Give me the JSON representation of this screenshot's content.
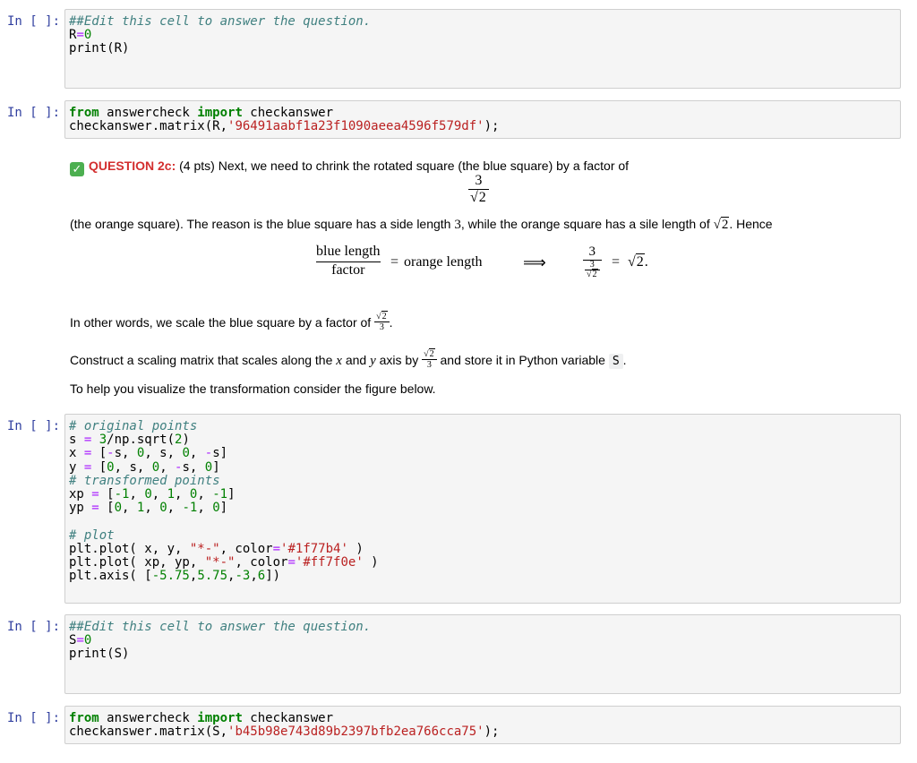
{
  "colors": {
    "prompt": "#303f9f",
    "cell_bg": "#f5f5f5",
    "question": "#d32f2f",
    "check": "#4caf50"
  },
  "cells": {
    "c1": {
      "prompt": "In [ ]:",
      "comment": "##Edit this cell to answer the question.",
      "line_a_var": "R",
      "line_a_eq": "=",
      "line_a_val": "0",
      "line_b": "print(R)"
    },
    "c2": {
      "prompt": "In [ ]:",
      "kw_from": "from",
      "module": " answercheck ",
      "kw_import": "import",
      "name": " checkanswer",
      "call": "checkanswer.matrix(R,",
      "hash": "'96491aabf1a23f1090aeea4596f579df'",
      "end": ");"
    },
    "c3": {
      "prompt": "In [ ]:",
      "comment1": "# original points",
      "comment2": "# transformed points",
      "comment3": "# plot",
      "s_line": [
        "s ",
        "= ",
        "3",
        "/np.sqrt(",
        "2",
        ")"
      ],
      "x_line": [
        "x ",
        "= ",
        "[",
        "-",
        "s, ",
        "0",
        ", s, ",
        "0",
        ", ",
        "-",
        "s]"
      ],
      "y_line": [
        "y ",
        "= ",
        "[",
        "0",
        ", s, ",
        "0",
        ", ",
        "-",
        "s, ",
        "0",
        "]"
      ],
      "xp_line": [
        "xp ",
        "= ",
        "[",
        "-1",
        ", ",
        "0",
        ", ",
        "1",
        ", ",
        "0",
        ", ",
        "-1",
        "]"
      ],
      "yp_line": [
        "yp ",
        "= ",
        "[",
        "0",
        ", ",
        "1",
        ", ",
        "0",
        ", ",
        "-1",
        ", ",
        "0",
        "]"
      ],
      "plot1": [
        "plt.plot( x, y, ",
        "\"*-\"",
        ", color",
        "=",
        "'#1f77b4'",
        " )"
      ],
      "plot2": [
        "plt.plot( xp, yp, ",
        "\"*-\"",
        ", color",
        "=",
        "'#ff7f0e'",
        " )"
      ],
      "axis": [
        "plt.axis( [",
        "-5.75",
        ",",
        "5.75",
        ",",
        "-3",
        ",",
        "6",
        "])"
      ]
    },
    "c4": {
      "prompt": "In [ ]:",
      "comment": "##Edit this cell to answer the question.",
      "line_a_var": "S",
      "line_a_eq": "=",
      "line_a_val": "0",
      "line_b": "print(S)"
    },
    "c5": {
      "prompt": "In [ ]:",
      "kw_from": "from",
      "module": " answercheck ",
      "kw_import": "import",
      "name": " checkanswer",
      "call": "checkanswer.matrix(S,",
      "hash": "'b45b98e743d89b2397bfb2ea766cca75'",
      "end": ");"
    }
  },
  "markdown": {
    "check_icon": "check-mark-icon",
    "check_glyph": "✓",
    "q_label": "QUESTION 2c:",
    "q_text1": " (4 pts) Next, we need to chrink the rotated square (the blue square) by a factor of",
    "frac1_num": "3",
    "frac1_den": "2",
    "para2_a": "(the orange square). The reason is the blue square has a side length ",
    "para2_3": "3",
    "para2_b": ", while the orange square has a sile length of ",
    "para2_c": ". Hence",
    "eq_blue_length": "blue length",
    "eq_factor": "factor",
    "eq_equals": "=",
    "eq_orange_length": "orange length",
    "eq_implies": "⟹",
    "eq_r_num": "3",
    "eq_r_inner_num": "3",
    "eq_r_inner_den": "2",
    "eq_r_equals": "=",
    "eq_r_val": "2",
    "eq_period": ".",
    "para3": "In other words, we scale the blue square by a factor of ",
    "para3_frac_num": "2",
    "para3_frac_den": "3",
    "para3_end": ".",
    "para4_a": "Construct a scaling matrix that scales along the ",
    "para4_x": "x",
    "para4_and": " and ",
    "para4_y": "y",
    "para4_b": " axis by ",
    "para4_frac_num": "2",
    "para4_frac_den": "3",
    "para4_c": " and store it in Python variable ",
    "para4_var": "S",
    "para4_end": ".",
    "para5": "To help you visualize the transformation consider the figure below."
  }
}
